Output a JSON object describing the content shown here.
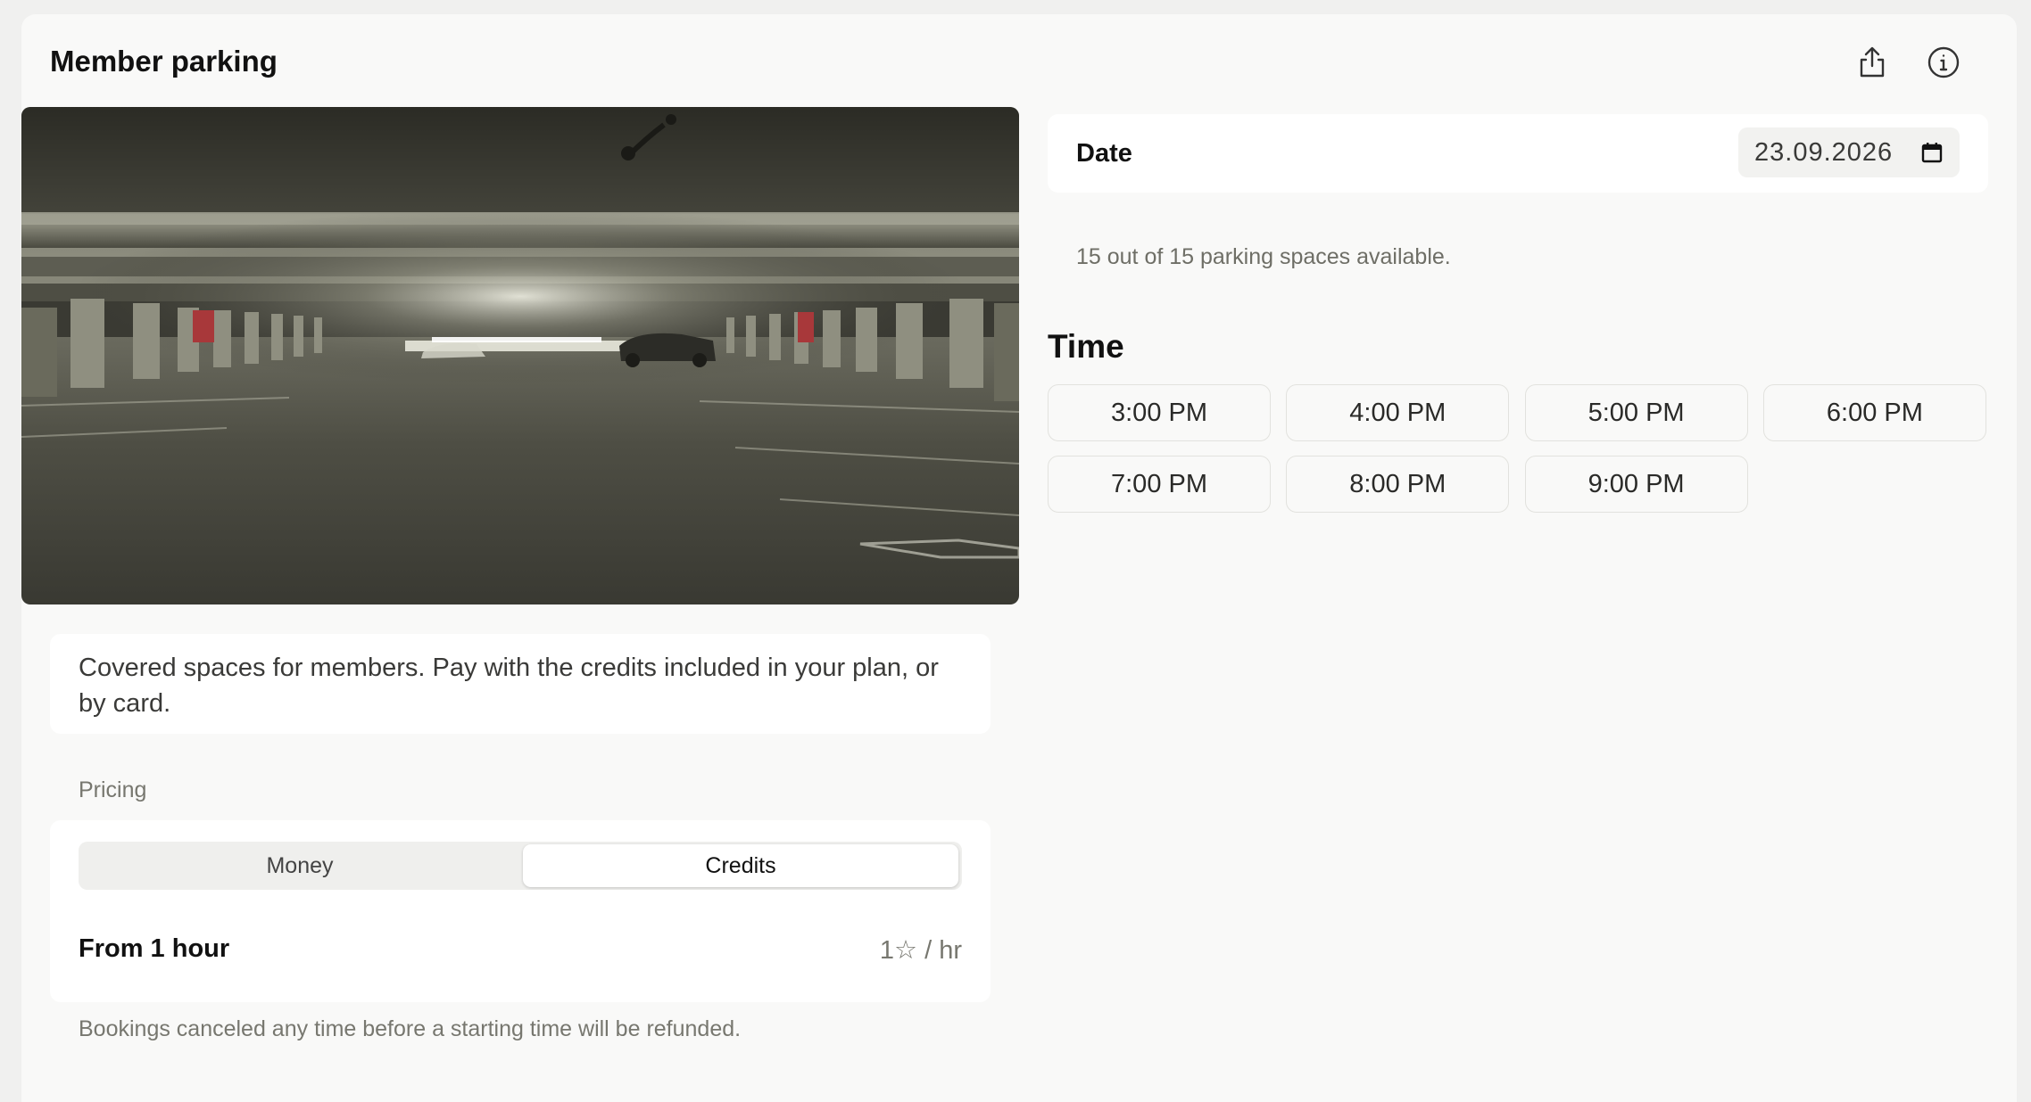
{
  "header": {
    "title": "Member parking",
    "share_icon": "share-icon",
    "info_icon": "info-icon"
  },
  "hero_image": {
    "subject": "Indoor parking garage",
    "tint": "#5a5a4e"
  },
  "description": "Covered spaces for members. Pay with the credits included in your plan, or by card.",
  "pricing": {
    "label": "Pricing",
    "tabs": [
      "Money",
      "Credits"
    ],
    "selected_tab": "Credits",
    "rate_label": "From 1 hour",
    "rate_value": "1☆ / hr",
    "note": "Bookings canceled any time before a starting time will be refunded."
  },
  "booking": {
    "date_label": "Date",
    "date_value": "23.09.2026",
    "calendar_icon": "calendar-icon",
    "availability": "15 out of 15 parking spaces available.",
    "time_heading": "Time",
    "time_slots": [
      "3:00 PM",
      "4:00 PM",
      "5:00 PM",
      "6:00 PM",
      "7:00 PM",
      "8:00 PM",
      "9:00 PM"
    ]
  }
}
